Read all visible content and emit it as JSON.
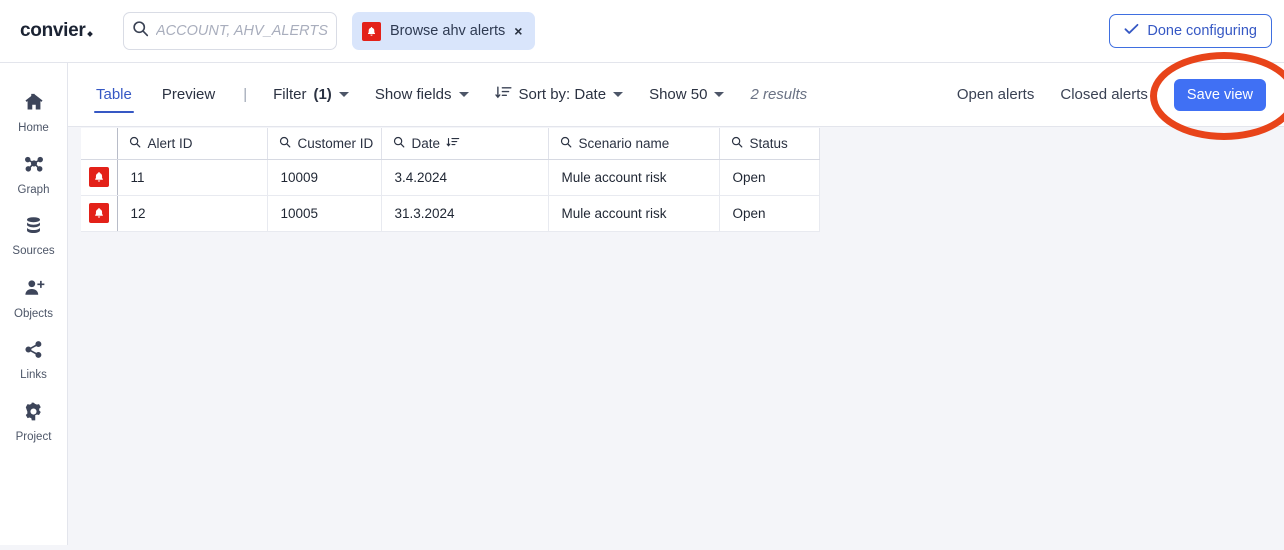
{
  "app": {
    "brand": "convier",
    "accent_blue": "#4070f4",
    "annotation_color": "#e8441a",
    "alert_red": "#e32119"
  },
  "topbar": {
    "search": {
      "placeholder": "ACCOUNT, AHV_ALERTS, CUSTOMER",
      "value": "",
      "icon": "search-icon"
    },
    "chip": {
      "label": "Browse ahv alerts",
      "icon": "alert-bell-icon",
      "close": "×"
    },
    "done_button": {
      "label": "Done configuring",
      "icon": "check-icon"
    }
  },
  "sidebar": {
    "items": [
      {
        "label": "Home",
        "icon": "home-icon"
      },
      {
        "label": "Graph",
        "icon": "graph-nodes-icon"
      },
      {
        "label": "Sources",
        "icon": "database-icon"
      },
      {
        "label": "Objects",
        "icon": "person-add-icon"
      },
      {
        "label": "Links",
        "icon": "share-links-icon"
      },
      {
        "label": "Project",
        "icon": "gear-icon"
      }
    ]
  },
  "toolbar": {
    "tabs": [
      {
        "label": "Table",
        "active": true
      },
      {
        "label": "Preview",
        "active": false
      }
    ],
    "divider": "|",
    "filter": {
      "label": "Filter",
      "count": "(1)"
    },
    "show_fields": {
      "label": "Show fields"
    },
    "sort": {
      "label": "Sort by: Date",
      "icon": "sort-descending-icon"
    },
    "page_size": {
      "label": "Show 50"
    },
    "results": "2 results",
    "open_alerts": "Open alerts",
    "closed_alerts": "Closed alerts",
    "save_view": "Save view"
  },
  "table": {
    "columns": [
      {
        "key": "alert_id",
        "label": "Alert ID",
        "icon": "search-icon",
        "sorted": false
      },
      {
        "key": "customer_id",
        "label": "Customer ID",
        "icon": "search-icon",
        "sorted": false
      },
      {
        "key": "date",
        "label": "Date",
        "icon": "search-icon",
        "sorted": true
      },
      {
        "key": "scenario_name",
        "label": "Scenario name",
        "icon": "search-icon",
        "sorted": false
      },
      {
        "key": "status",
        "label": "Status",
        "icon": "search-icon",
        "sorted": false
      }
    ],
    "rows": [
      {
        "row_icon": "alert-bell-icon",
        "alert_id": "11",
        "customer_id": "10009",
        "date": "3.4.2024",
        "scenario_name": "Mule account risk",
        "status": "Open"
      },
      {
        "row_icon": "alert-bell-icon",
        "alert_id": "12",
        "customer_id": "10005",
        "date": "31.3.2024",
        "scenario_name": "Mule account risk",
        "status": "Open"
      }
    ]
  },
  "annotation": {
    "shape": "ellipse-highlight",
    "target": "Save view"
  }
}
